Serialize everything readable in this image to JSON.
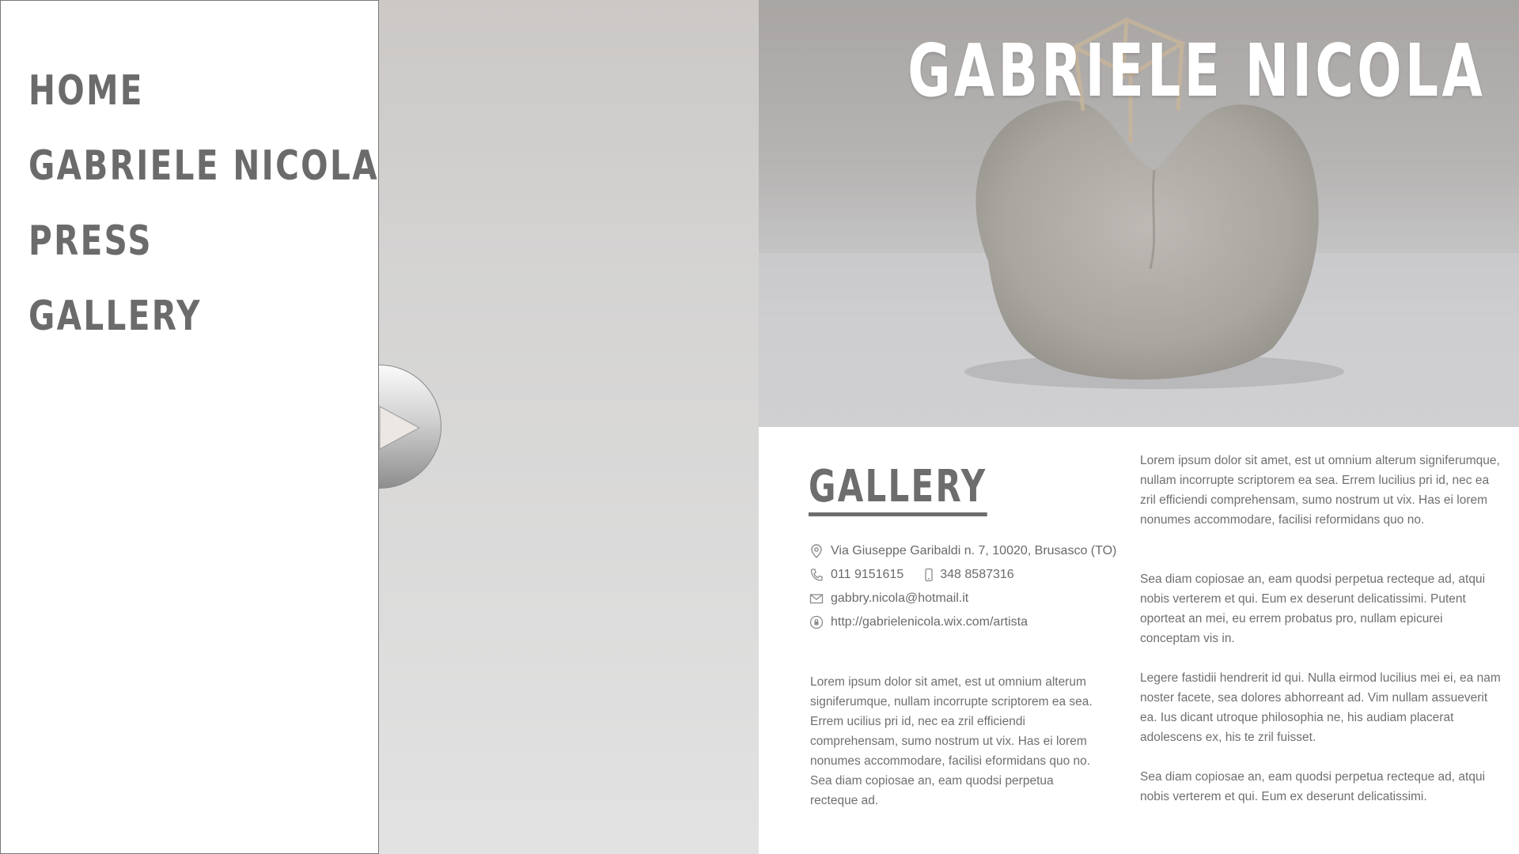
{
  "nav": {
    "items": [
      {
        "label": "HOME"
      },
      {
        "label": "GABRIELE NICOLA"
      },
      {
        "label": "PRESS"
      },
      {
        "label": "GALLERY"
      }
    ]
  },
  "hero": {
    "title": "GABRIELE NICOLA"
  },
  "section": {
    "heading": "GALLERY"
  },
  "contact": {
    "address": "Via Giuseppe Garibaldi n. 7, 10020, Brusasco (TO)",
    "phone": "011 9151615",
    "mobile": "348 8587316",
    "email": "gabbry.nicola@hotmail.it",
    "website": "http://gabrielenicola.wix.com/artista"
  },
  "texts": {
    "left_paragraph": "Lorem ipsum dolor sit amet, est ut omnium alterum signiferumque, nullam incorrupte scriptorem ea sea. Errem  ucilius pri id, nec ea zril efficiendi comprehensam, sumo nostrum ut vix. Has ei lorem nonumes accommodare, facilisi  eformidans quo no. Sea diam copiosae an, eam quodsi perpetua recteque ad.",
    "right_paragraphs": [
      "Lorem ipsum dolor sit amet, est ut omnium alterum signiferumque, nullam incorrupte scriptorem ea sea. Errem lucilius pri id, nec ea zril efficiendi comprehensam, sumo nostrum ut vix. Has ei lorem nonumes accommodare, facilisi reformidans quo no.",
      "Sea diam copiosae an, eam quodsi perpetua recteque ad, atqui nobis verterem et qui. Eum ex deserunt delicatissimi. Putent oporteat an mei, eu errem probatus pro, nullam epicurei conceptam vis in.",
      "Legere fastidii hendrerit id qui. Nulla eirmod lucilius mei ei, ea nam noster facete, sea dolores abhorreant ad. Vim nullam assueverit ea. Ius dicant utroque philosophia ne, his audiam placerat adolescens ex, his te zril fuisset.",
      "Sea diam copiosae an, eam quodsi perpetua recteque ad, atqui nobis verterem et qui. Eum ex deserunt delicatissimi."
    ]
  },
  "icons": {
    "nav_toggle": "play-arrow-icon",
    "address": "map-pin-icon",
    "phone": "phone-icon",
    "mobile": "mobile-phone-icon",
    "email": "envelope-icon",
    "website": "globe-lock-icon"
  },
  "colors": {
    "nav_text": "#6b6b6b",
    "body_text": "#6f6f6f",
    "hero_title": "#ffffff",
    "sidebar_border": "#7a7a7a"
  }
}
